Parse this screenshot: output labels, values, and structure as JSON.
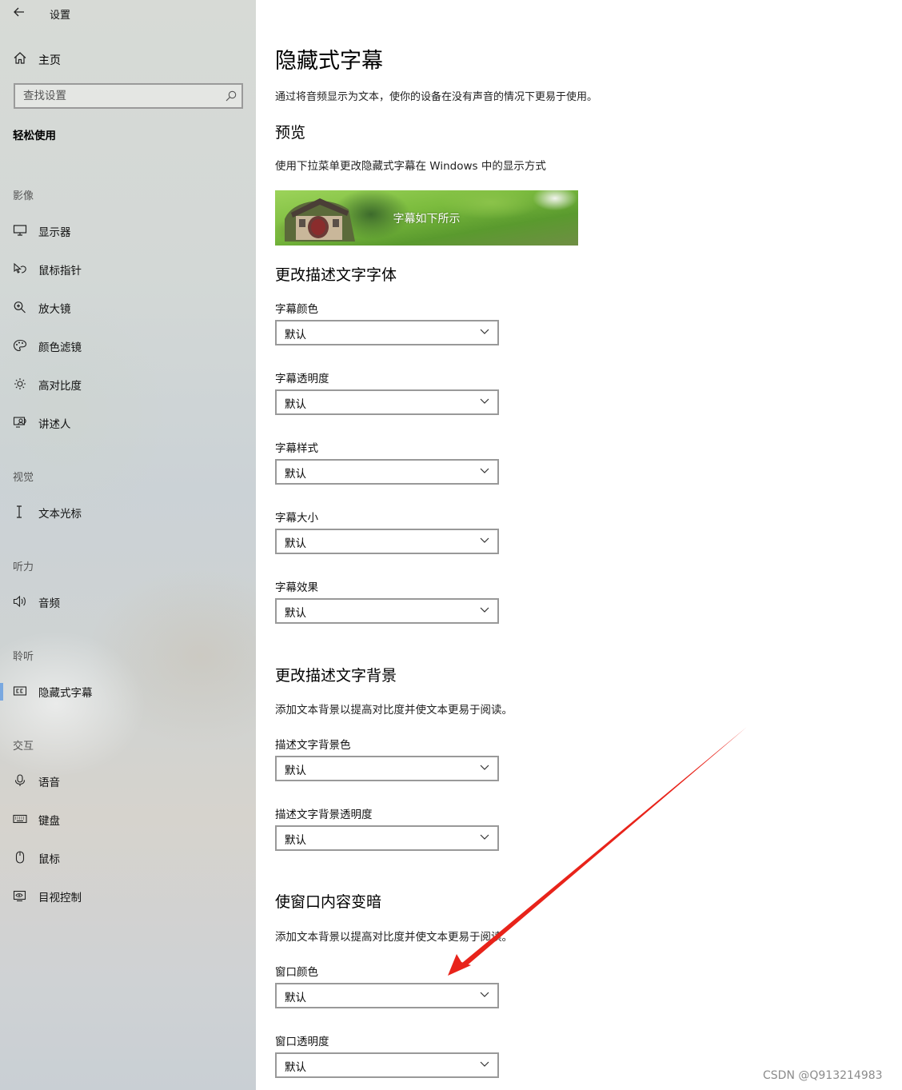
{
  "sidebar": {
    "title": "设置",
    "home_label": "主页",
    "search_placeholder": "查找设置",
    "category": "轻松使用",
    "groups": {
      "vision": "影像",
      "view": "视觉",
      "hearing": "听力",
      "listen": "聆听",
      "interaction": "交互"
    },
    "items": {
      "display": "显示器",
      "mouse_pointer": "鼠标指针",
      "magnifier": "放大镜",
      "color_filters": "颜色滤镜",
      "high_contrast": "高对比度",
      "narrator": "讲述人",
      "text_cursor": "文本光标",
      "audio": "音频",
      "closed_captions": "隐藏式字幕",
      "speech": "语音",
      "keyboard": "键盘",
      "mouse": "鼠标",
      "eye_control": "目视控制"
    },
    "active_item": "closed_captions"
  },
  "main": {
    "title": "隐藏式字幕",
    "intro": "通过将音频显示为文本，使你的设备在没有声音的情况下更易于使用。",
    "preview": {
      "heading": "预览",
      "desc": "使用下拉菜单更改隐藏式字幕在 Windows 中的显示方式",
      "caption_text": "字幕如下所示"
    },
    "font_section": {
      "heading": "更改描述文字字体",
      "fields": {
        "color": {
          "label": "字幕颜色",
          "value": "默认"
        },
        "transparency": {
          "label": "字幕透明度",
          "value": "默认"
        },
        "style": {
          "label": "字幕样式",
          "value": "默认"
        },
        "size": {
          "label": "字幕大小",
          "value": "默认"
        },
        "effects": {
          "label": "字幕效果",
          "value": "默认"
        }
      }
    },
    "background_section": {
      "heading": "更改描述文字背景",
      "desc": "添加文本背景以提高对比度并使文本更易于阅读。",
      "fields": {
        "color": {
          "label": "描述文字背景色",
          "value": "默认"
        },
        "transparency": {
          "label": "描述文字背景透明度",
          "value": "默认"
        }
      }
    },
    "window_section": {
      "heading": "使窗口内容变暗",
      "desc": "添加文本背景以提高对比度并使文本更易于阅读。",
      "fields": {
        "color": {
          "label": "窗口颜色",
          "value": "默认"
        },
        "transparency": {
          "label": "窗口透明度",
          "value": "默认"
        }
      }
    }
  },
  "annotation": {
    "arrow_color": "#e8231a"
  },
  "watermark": "CSDN @Q913214983",
  "colors": {
    "accent": "#79a8e0",
    "border": "#999999"
  }
}
